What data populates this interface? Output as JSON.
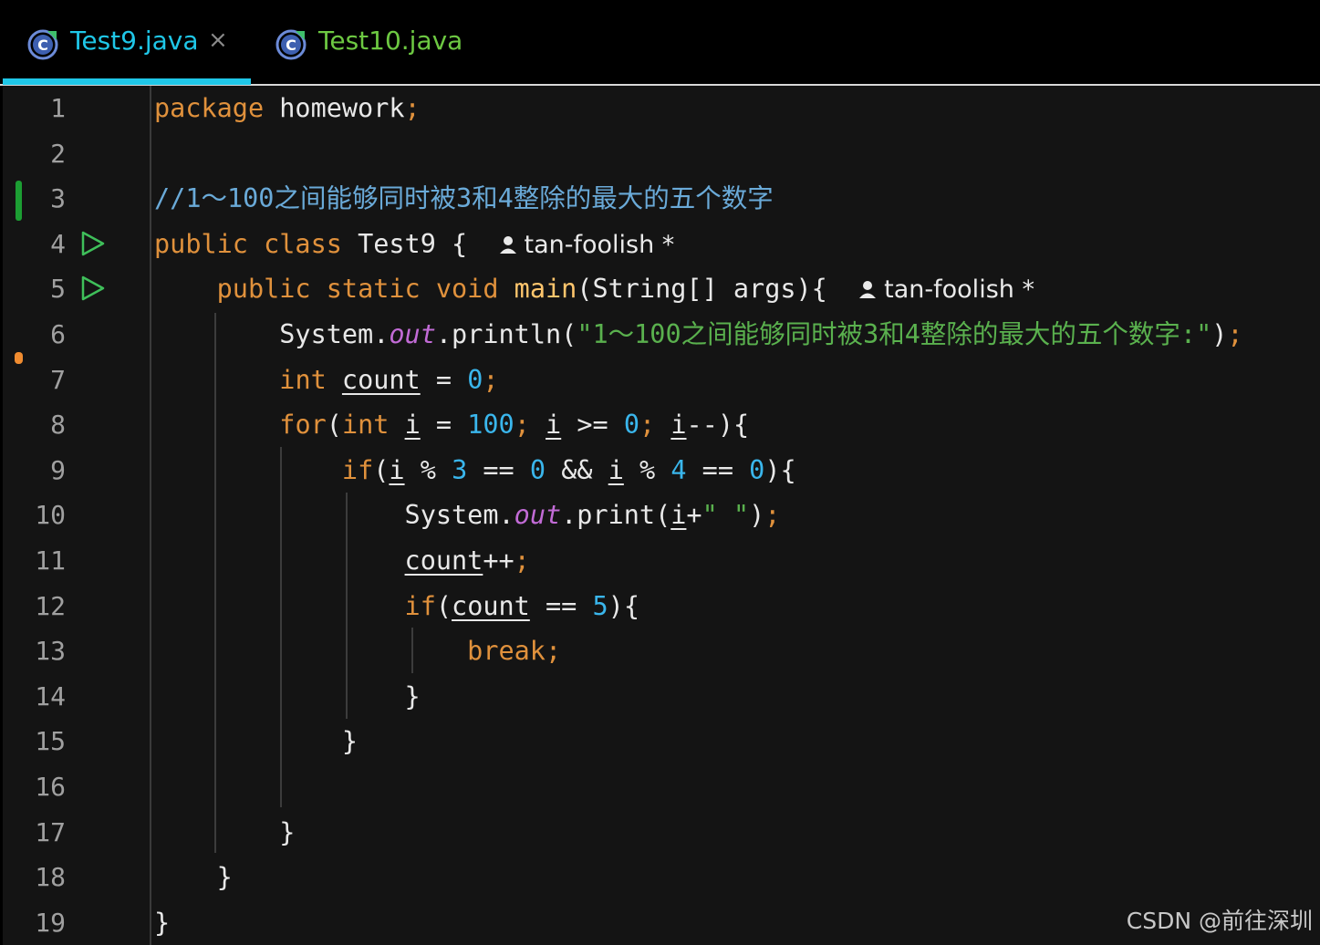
{
  "tabs": [
    {
      "label": "Test9.java",
      "color": "#1fc7e8",
      "active": true,
      "close": "×"
    },
    {
      "label": "Test10.java",
      "color": "#6dc842",
      "active": false
    }
  ],
  "lines": [
    {
      "n": "1",
      "tokens": [
        [
          "kw",
          "package"
        ],
        [
          "plain",
          " homework"
        ],
        [
          "kw",
          ";"
        ]
      ]
    },
    {
      "n": "2",
      "tokens": []
    },
    {
      "n": "3",
      "tokens": [
        [
          "cmt",
          "//1～100之间能够同时被3和4整除的最大的五个数字"
        ]
      ]
    },
    {
      "n": "4",
      "tokens": [
        [
          "kw",
          "public class "
        ],
        [
          "plain",
          "Test9 {  "
        ],
        [
          "author",
          "tan-foolish *"
        ]
      ],
      "run": true
    },
    {
      "n": "5",
      "tokens": [
        [
          "plain",
          "    "
        ],
        [
          "kw",
          "public static void "
        ],
        [
          "fn",
          "main"
        ],
        [
          "plain",
          "(String[] args){  "
        ],
        [
          "author",
          "tan-foolish *"
        ]
      ],
      "run": true
    },
    {
      "n": "6",
      "tokens": [
        [
          "plain",
          "        System."
        ],
        [
          "field",
          "out"
        ],
        [
          "plain",
          ".println("
        ],
        [
          "str",
          "\"1～100之间能够同时被3和4整除的最大的五个数字:\""
        ],
        [
          "plain",
          ")"
        ],
        [
          "kw",
          ";"
        ]
      ]
    },
    {
      "n": "7",
      "tokens": [
        [
          "plain",
          "        "
        ],
        [
          "kw",
          "int "
        ],
        [
          "var",
          "count"
        ],
        [
          "plain",
          " = "
        ],
        [
          "num",
          "0"
        ],
        [
          "kw",
          ";"
        ]
      ]
    },
    {
      "n": "8",
      "tokens": [
        [
          "plain",
          "        "
        ],
        [
          "kw",
          "for"
        ],
        [
          "plain",
          "("
        ],
        [
          "kw",
          "int "
        ],
        [
          "var",
          "i"
        ],
        [
          "plain",
          " = "
        ],
        [
          "num",
          "100"
        ],
        [
          "kw",
          "; "
        ],
        [
          "var",
          "i"
        ],
        [
          "plain",
          " >= "
        ],
        [
          "num",
          "0"
        ],
        [
          "kw",
          "; "
        ],
        [
          "var",
          "i"
        ],
        [
          "plain",
          "--){"
        ]
      ]
    },
    {
      "n": "9",
      "tokens": [
        [
          "plain",
          "            "
        ],
        [
          "kw",
          "if"
        ],
        [
          "plain",
          "("
        ],
        [
          "var",
          "i"
        ],
        [
          "plain",
          " % "
        ],
        [
          "num",
          "3"
        ],
        [
          "plain",
          " == "
        ],
        [
          "num",
          "0"
        ],
        [
          "plain",
          " && "
        ],
        [
          "var",
          "i"
        ],
        [
          "plain",
          " % "
        ],
        [
          "num",
          "4"
        ],
        [
          "plain",
          " == "
        ],
        [
          "num",
          "0"
        ],
        [
          "plain",
          "){"
        ]
      ]
    },
    {
      "n": "10",
      "tokens": [
        [
          "plain",
          "                System."
        ],
        [
          "field",
          "out"
        ],
        [
          "plain",
          ".print("
        ],
        [
          "var",
          "i"
        ],
        [
          "plain",
          "+"
        ],
        [
          "str",
          "\" \""
        ],
        [
          "plain",
          ")"
        ],
        [
          "kw",
          ";"
        ]
      ]
    },
    {
      "n": "11",
      "tokens": [
        [
          "plain",
          "                "
        ],
        [
          "var",
          "count"
        ],
        [
          "plain",
          "++"
        ],
        [
          "kw",
          ";"
        ]
      ]
    },
    {
      "n": "12",
      "tokens": [
        [
          "plain",
          "                "
        ],
        [
          "kw",
          "if"
        ],
        [
          "plain",
          "("
        ],
        [
          "var",
          "count"
        ],
        [
          "plain",
          " == "
        ],
        [
          "num",
          "5"
        ],
        [
          "plain",
          "){"
        ]
      ]
    },
    {
      "n": "13",
      "tokens": [
        [
          "plain",
          "                    "
        ],
        [
          "kw",
          "break;"
        ]
      ]
    },
    {
      "n": "14",
      "tokens": [
        [
          "plain",
          "                }"
        ]
      ]
    },
    {
      "n": "15",
      "tokens": [
        [
          "plain",
          "            }"
        ]
      ]
    },
    {
      "n": "16",
      "tokens": []
    },
    {
      "n": "17",
      "tokens": [
        [
          "plain",
          "        }"
        ]
      ]
    },
    {
      "n": "18",
      "tokens": [
        [
          "plain",
          "    }"
        ]
      ]
    },
    {
      "n": "19",
      "tokens": [
        [
          "plain",
          "}"
        ]
      ]
    }
  ],
  "watermark": "CSDN @前往深圳"
}
